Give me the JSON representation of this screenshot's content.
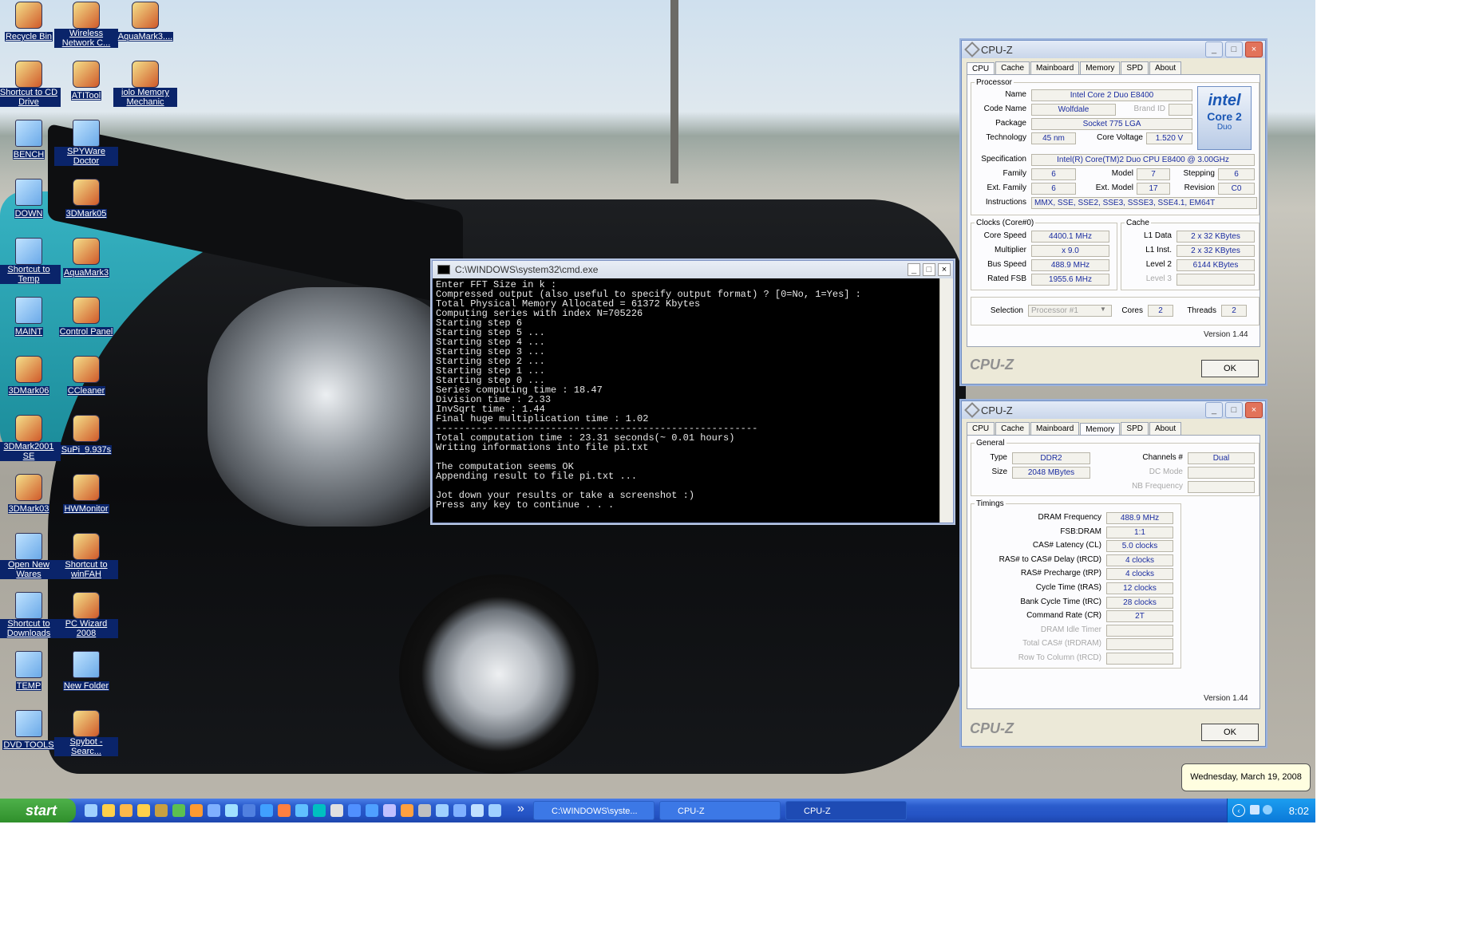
{
  "desktop_icons": [
    {
      "label": "Recycle Bin",
      "icon": "recycle-bin-icon"
    },
    {
      "label": "Wireless Network C...",
      "icon": "network-icon"
    },
    {
      "label": "AquaMark3....",
      "icon": "aquamark-icon"
    },
    {
      "label": "Shortcut to CD Drive",
      "icon": "cd-drive-icon"
    },
    {
      "label": "ATITool",
      "icon": "atitool-icon"
    },
    {
      "label": "iolo Memory Mechanic",
      "icon": "memory-mechanic-icon"
    },
    {
      "label": "BENCH",
      "icon": "folder-icon"
    },
    {
      "label": "SPYWare Doctor",
      "icon": "folder-icon"
    },
    {
      "label": "DOWN",
      "icon": "folder-icon"
    },
    {
      "label": "3DMark05",
      "icon": "3dmark-icon"
    },
    {
      "label": "Shortcut to Temp",
      "icon": "folder-icon"
    },
    {
      "label": "AquaMark3",
      "icon": "aquamark-icon"
    },
    {
      "label": "MAINT",
      "icon": "folder-icon"
    },
    {
      "label": "Control Panel",
      "icon": "control-panel-icon"
    },
    {
      "label": "3DMark06",
      "icon": "3dmark-icon"
    },
    {
      "label": "CCleaner",
      "icon": "ccleaner-icon"
    },
    {
      "label": "3DMark2001 SE",
      "icon": "3dmark-icon"
    },
    {
      "label": "SuPi_9.937s",
      "icon": "superpi-icon"
    },
    {
      "label": "3DMark03",
      "icon": "3dmark-icon"
    },
    {
      "label": "HWMonitor",
      "icon": "hwmonitor-icon"
    },
    {
      "label": "Open New Wares",
      "icon": "folder-icon"
    },
    {
      "label": "Shortcut to winFAH",
      "icon": "winfah-icon"
    },
    {
      "label": "Shortcut to Downloads",
      "icon": "folder-icon"
    },
    {
      "label": "PC Wizard 2008",
      "icon": "pcwizard-icon"
    },
    {
      "label": "TEMP",
      "icon": "folder-icon"
    },
    {
      "label": "New Folder",
      "icon": "folder-icon"
    },
    {
      "label": "DVD TOOLS",
      "icon": "folder-icon"
    },
    {
      "label": "Spybot - Searc...",
      "icon": "spybot-icon"
    }
  ],
  "cmd": {
    "title": "C:\\WINDOWS\\system32\\cmd.exe",
    "lines": [
      "Enter FFT Size in k :",
      "Compressed output (also useful to specify output format) ? [0=No, 1=Yes] :",
      "Total Physical Memory Allocated = 61372 Kbytes",
      "Computing series with index N=705226",
      "Starting step 6",
      "Starting step 5 ...",
      "Starting step 4 ...",
      "Starting step 3 ...",
      "Starting step 2 ...",
      "Starting step 1 ...",
      "Starting step 0 ...",
      "Series computing time : 18.47",
      "Division time : 2.33",
      "InvSqrt time : 1.44",
      "Final huge multiplication time : 1.02",
      "--------------------------------------------------------",
      "Total computation time : 23.31 seconds(~ 0.01 hours)",
      "Writing informations into file pi.txt",
      "",
      "The computation seems OK",
      "Appending result to file pi.txt ...",
      "",
      "Jot down your results or take a screenshot :)",
      "Press any key to continue . . ."
    ]
  },
  "cpuz_cpu": {
    "title": "CPU-Z",
    "tabs": [
      "CPU",
      "Cache",
      "Mainboard",
      "Memory",
      "SPD",
      "About"
    ],
    "active_tab": "CPU",
    "processor_group": "Processor",
    "name_label": "Name",
    "name": "Intel Core 2 Duo E8400",
    "codename_label": "Code Name",
    "codename": "Wolfdale",
    "brand_id_label": "Brand ID",
    "package_label": "Package",
    "package": "Socket 775 LGA",
    "technology_label": "Technology",
    "technology": "45 nm",
    "core_voltage_label": "Core Voltage",
    "core_voltage": "1.520 V",
    "specification_label": "Specification",
    "specification": "Intel(R) Core(TM)2 Duo CPU    E8400  @ 3.00GHz",
    "family_label": "Family",
    "family": "6",
    "model_label": "Model",
    "model": "7",
    "stepping_label": "Stepping",
    "stepping": "6",
    "ext_family_label": "Ext. Family",
    "ext_family": "6",
    "ext_model_label": "Ext. Model",
    "ext_model": "17",
    "revision_label": "Revision",
    "revision": "C0",
    "instructions_label": "Instructions",
    "instructions": "MMX, SSE, SSE2, SSE3, SSSE3, SSE4.1, EM64T",
    "clocks_group": "Clocks (Core#0)",
    "core_speed_label": "Core Speed",
    "core_speed": "4400.1 MHz",
    "multiplier_label": "Multiplier",
    "multiplier": "x 9.0",
    "bus_speed_label": "Bus Speed",
    "bus_speed": "488.9 MHz",
    "rated_fsb_label": "Rated FSB",
    "rated_fsb": "1955.6 MHz",
    "cache_group": "Cache",
    "l1_data_label": "L1 Data",
    "l1_data": "2 x 32 KBytes",
    "l1_inst_label": "L1 Inst.",
    "l1_inst": "2 x 32 KBytes",
    "level2_label": "Level 2",
    "level2": "6144 KBytes",
    "level3_label": "Level 3",
    "selection_label": "Selection",
    "selection": "Processor #1",
    "cores_label": "Cores",
    "cores": "2",
    "threads_label": "Threads",
    "threads": "2",
    "version": "Version 1.44",
    "brand": "CPU-Z",
    "ok": "OK",
    "logo_top": "intel",
    "logo_mid": "Core 2",
    "logo_bottom": "Duo"
  },
  "cpuz_mem": {
    "title": "CPU-Z",
    "tabs": [
      "CPU",
      "Cache",
      "Mainboard",
      "Memory",
      "SPD",
      "About"
    ],
    "active_tab": "Memory",
    "general_group": "General",
    "type_label": "Type",
    "type": "DDR2",
    "size_label": "Size",
    "size": "2048 MBytes",
    "channels_label": "Channels #",
    "channels": "Dual",
    "dc_mode_label": "DC Mode",
    "nb_freq_label": "NB Frequency",
    "timings_group": "Timings",
    "timings": [
      {
        "label": "DRAM Frequency",
        "value": "488.9 MHz",
        "dim": false
      },
      {
        "label": "FSB:DRAM",
        "value": "1:1",
        "dim": false
      },
      {
        "label": "CAS# Latency (CL)",
        "value": "5.0 clocks",
        "dim": false
      },
      {
        "label": "RAS# to CAS# Delay (tRCD)",
        "value": "4 clocks",
        "dim": false
      },
      {
        "label": "RAS# Precharge (tRP)",
        "value": "4 clocks",
        "dim": false
      },
      {
        "label": "Cycle Time (tRAS)",
        "value": "12 clocks",
        "dim": false
      },
      {
        "label": "Bank Cycle Time (tRC)",
        "value": "28 clocks",
        "dim": false
      },
      {
        "label": "Command Rate (CR)",
        "value": "2T",
        "dim": false
      },
      {
        "label": "DRAM Idle Timer",
        "value": "",
        "dim": true
      },
      {
        "label": "Total CAS# (tRDRAM)",
        "value": "",
        "dim": true
      },
      {
        "label": "Row To Column (tRCD)",
        "value": "",
        "dim": true
      }
    ],
    "version": "Version 1.44",
    "brand": "CPU-Z",
    "ok": "OK"
  },
  "taskbar": {
    "start_label": "start",
    "buttons": [
      {
        "label": "C:\\WINDOWS\\syste...",
        "active": false
      },
      {
        "label": "CPU-Z",
        "active": false
      },
      {
        "label": "CPU-Z",
        "active": true
      }
    ],
    "overflow": "»",
    "clock": "8:02"
  },
  "balloon": {
    "date": "Wednesday, March 19, 2008"
  }
}
